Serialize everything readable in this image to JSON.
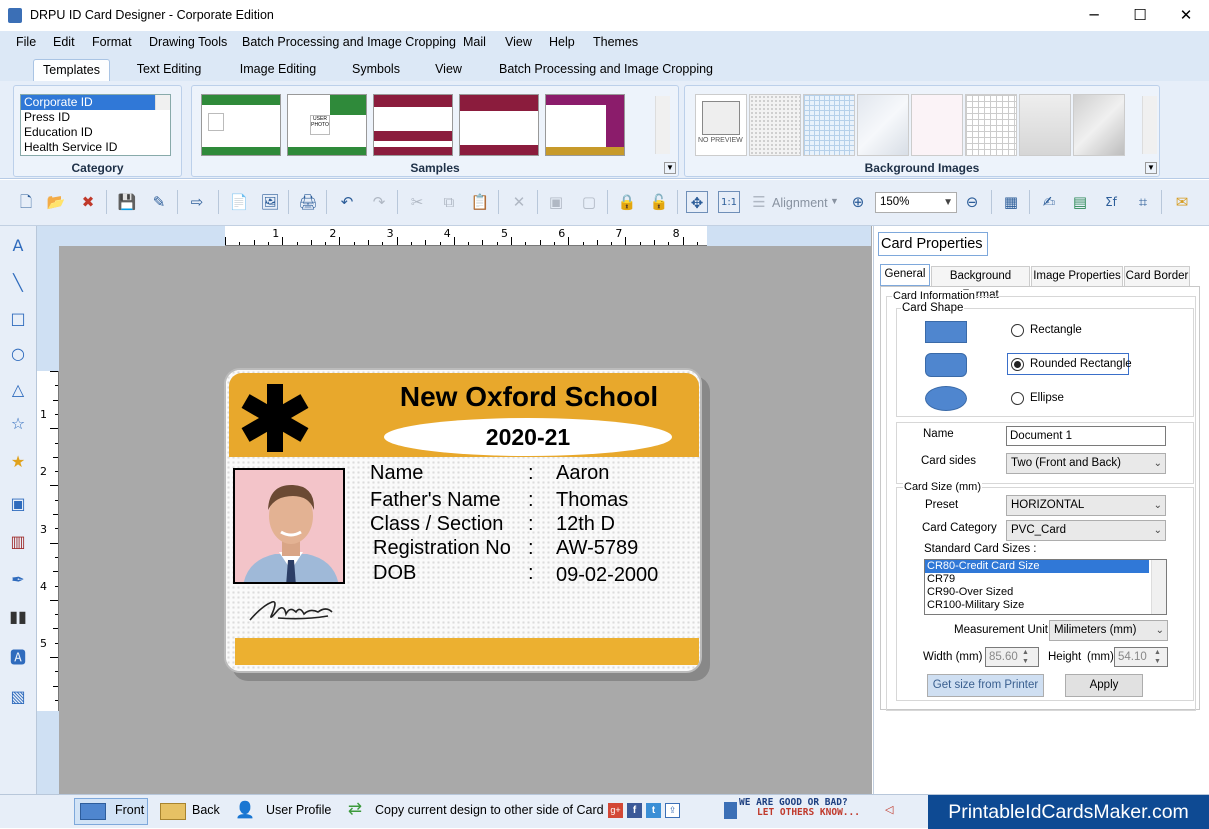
{
  "window": {
    "title": "DRPU ID Card Designer - Corporate Edition",
    "minimize": "─",
    "maximize": "☐",
    "close": "✕"
  },
  "menu": [
    "File",
    "Edit",
    "Format",
    "Drawing Tools",
    "Batch Processing and Image Cropping",
    "Mail",
    "View",
    "Help",
    "Themes"
  ],
  "ribbon_tabs": [
    "Templates",
    "Text Editing",
    "Image Editing",
    "Symbols",
    "View",
    "Batch Processing and Image Cropping"
  ],
  "ribbon": {
    "category_label": "Category",
    "categories": [
      "Corporate ID",
      "Press ID",
      "Education ID",
      "Health Service ID"
    ],
    "samples_label": "Samples",
    "background_label": "Background Images",
    "no_preview": "NO PREVIEW",
    "user_photo": "USER PHOTO"
  },
  "toolbar": {
    "alignment": "Alignment",
    "zoom": "150%"
  },
  "ruler": {
    "h": [
      "1",
      "2",
      "3",
      "4",
      "5",
      "6",
      "7",
      "8"
    ],
    "v": [
      "1",
      "2",
      "3",
      "4",
      "5"
    ]
  },
  "card": {
    "school": "New Oxford  School",
    "year": "2020-21",
    "fields": [
      {
        "label": "Name",
        "value": "Aaron"
      },
      {
        "label": "Father's Name",
        "value": "Thomas"
      },
      {
        "label": "Class / Section",
        "value": "12th D"
      },
      {
        "label": "Registration No",
        "value": "AW-5789"
      },
      {
        "label": "DOB",
        "value": "09-02-2000"
      }
    ],
    "colon": ":",
    "header_color": "#e8a82c"
  },
  "panel": {
    "title": "Card Properties",
    "tabs": [
      "General",
      "Background Format",
      "Image Properties",
      "Card Border"
    ],
    "card_info": "Card Information",
    "card_shape": "Card Shape",
    "shapes": [
      "Rectangle",
      "Rounded Rectangle",
      "Ellipse"
    ],
    "selected_shape": "Rounded Rectangle",
    "name_label": "Name",
    "name_value": "Document 1",
    "sides_label": "Card sides",
    "sides_value": "Two (Front and Back)",
    "size_group": "Card Size (mm)",
    "preset_label": "Preset",
    "preset_value": "HORIZONTAL",
    "category_label": "Card Category",
    "category_value": "PVC_Card",
    "std_label": "Standard Card Sizes :",
    "std_sizes": [
      "CR80-Credit Card Size",
      "CR79",
      "CR90-Over Sized",
      "CR100-Military Size"
    ],
    "unit_label": "Measurement Unit :",
    "unit_value": "Milimeters (mm)",
    "width_label": "Width  (mm)",
    "width_value": "85.60",
    "height_label": "Height",
    "height_unit": "(mm)",
    "height_value": "54.10",
    "get_size": "Get size from Printer",
    "apply": "Apply"
  },
  "status": {
    "front": "Front",
    "back": "Back",
    "user_profile": "User Profile",
    "copy": "Copy current design to other side of Card",
    "feedback_line1": "WE ARE GOOD OR BAD?",
    "feedback_line2": "LET OTHERS KNOW...",
    "brand": "PrintableIdCardsMaker.com"
  }
}
